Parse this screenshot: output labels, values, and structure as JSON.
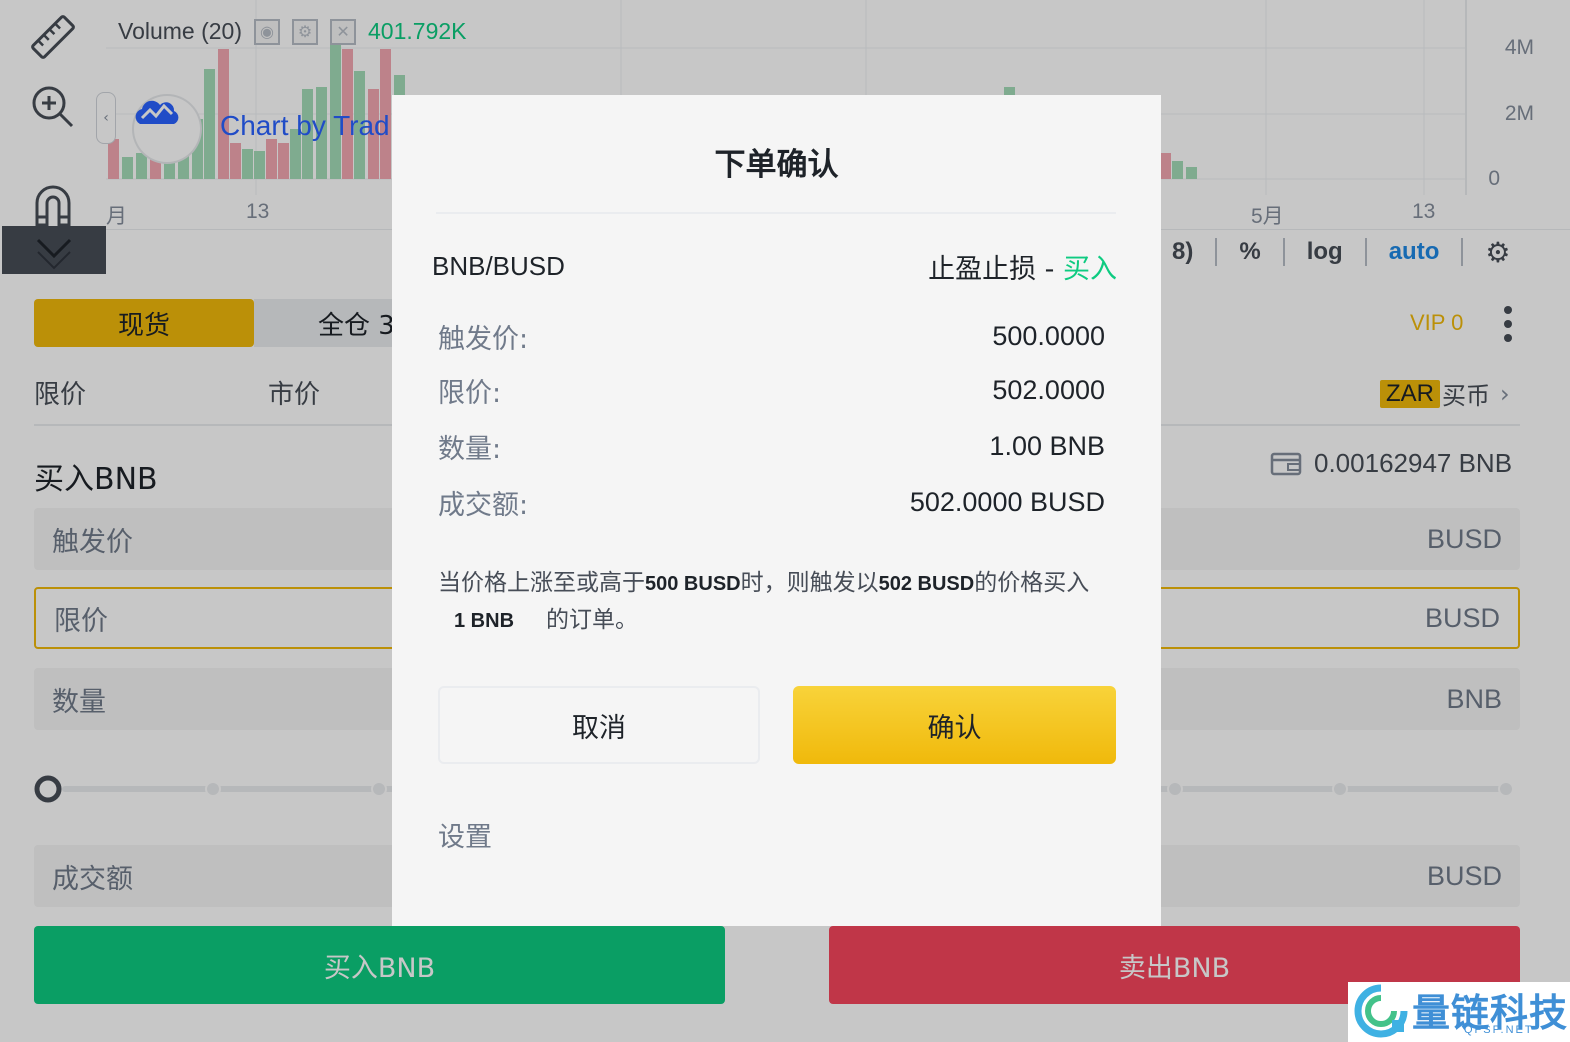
{
  "chart": {
    "volume_label": "Volume (20)",
    "volume_value": "401.792K",
    "tradingview_text": "Chart by Trad",
    "y_ticks": [
      "4M",
      "2M",
      "0"
    ],
    "x_ticks": [
      "月",
      "13",
      "5月",
      "13"
    ],
    "scale_buttons": {
      "partial": "8)",
      "percent": "%",
      "log": "log",
      "auto": "auto"
    }
  },
  "form": {
    "tabs": {
      "spot": "现货",
      "cross": "全仓 3"
    },
    "vip": "VIP 0",
    "order_types": {
      "limit": "限价",
      "market": "市价"
    },
    "zar": {
      "badge": "ZAR",
      "label": "买币"
    },
    "buy_title": "买入BNB",
    "balance": "0.00162947 BNB",
    "fields": [
      {
        "placeholder": "触发价",
        "unit": "BUSD"
      },
      {
        "placeholder": "限价",
        "unit": "BUSD"
      },
      {
        "placeholder": "数量",
        "unit": "BNB"
      },
      {
        "placeholder": "成交额",
        "unit": "BUSD"
      }
    ],
    "buy_button": "买入BNB",
    "sell_button": "卖出BNB"
  },
  "modal": {
    "title": "下单确认",
    "pair": "BNB/BUSD",
    "order_type": "止盈止损 - ",
    "order_side": "买入",
    "rows": [
      {
        "label": "触发价:",
        "value": "500.0000"
      },
      {
        "label": "限价:",
        "value": "502.0000"
      },
      {
        "label": "数量:",
        "value": "1.00 BNB"
      },
      {
        "label": "成交额:",
        "value": "502.0000 BUSD"
      }
    ],
    "description": {
      "part1": "当价格上涨至或高于",
      "trigger": "500 BUSD",
      "part2": "时，则触发以",
      "limit": "502 BUSD",
      "part3": "的价格买入",
      "qty": "1 BNB",
      "part4": "的订单。"
    },
    "cancel": "取消",
    "confirm": "确认",
    "settings": "设置"
  },
  "watermark": {
    "text": "量链科技",
    "sub": "QFSP.NET"
  },
  "colors": {
    "accent": "#f0b90b",
    "buy": "#0ecb81",
    "sell": "#f6465d",
    "link": "#1e88e5"
  }
}
